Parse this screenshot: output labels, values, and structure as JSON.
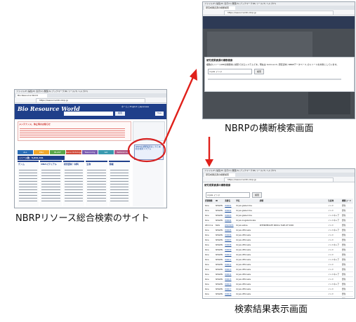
{
  "captions": {
    "shot1": "NBRPリソース総合検索のサイト",
    "shot2": "NBRPの横断検索画面",
    "shot3": "検索結果表示画面"
  },
  "browser": {
    "menu": "ファイル(F) 編集(E) 表示(V) 履歴(S) ブックマーク(B) ツール(T) ヘルプ(H)",
    "url": "https://resourceinfo.nbrp.jp"
  },
  "shot1": {
    "site_title": "Bio Resource World",
    "lang": "ホーム | English | Japanese",
    "search_button": "検索",
    "notice_title": "メンテナンス、休止等のお知らせ",
    "resources_header": "リソース数：5,042,461",
    "help": "Help",
    "cat_tabs": [
      "ALL",
      "DNA",
      "BLAST",
      "Gene Ontology",
      "Taxonomy",
      "GO",
      "Reference"
    ],
    "columns": [
      "ゲノム",
      "DNAマテリアル",
      "研究資材・材料",
      "生物",
      "情報"
    ],
    "link_box": "NBRPの横断検索はこちら ▶ 統合検索システム"
  },
  "shot2": {
    "heading": "研究成果資源の横断検索",
    "desc": "複数のリソースDBを横断的に検索できるシステムです。現在は SciCrunch, 研究資材, NBRPデータベース のリソースを対象としています。",
    "input_value": "oryza インド",
    "search_button": "検索"
  },
  "shot3": {
    "heading": "研究成果資源の横断検索",
    "input_value": "oryza インド",
    "search_button": "検索",
    "columns": [
      "資源種類",
      "ID",
      "系統名",
      "学名",
      "詳細",
      "生産地",
      "機関コード"
    ],
    "rows": [
      {
        "kind": "Rice",
        "db": "SHIGEN",
        "id": "W0001",
        "name": "Oryza glaberrima",
        "note": "",
        "origin": "インド",
        "inst": "野生"
      },
      {
        "kind": "Rice",
        "db": "SHIGEN",
        "id": "W0002",
        "name": "Oryza glaberrima",
        "note": "",
        "origin": "インド",
        "inst": "野生"
      },
      {
        "kind": "Rice",
        "db": "SHIGEN",
        "id": "W0003",
        "name": "Oryza glaberrima",
        "note": "",
        "origin": "インドネシア",
        "inst": "野生"
      },
      {
        "kind": "Rice",
        "db": "SHIGEN",
        "id": "W0004",
        "name": "Oryza longistaminata",
        "note": "",
        "origin": "インドネシア",
        "inst": "野生"
      },
      {
        "kind": "Wild rice",
        "db": "NIAS",
        "id": "JP203055",
        "name": "Oryza sativa",
        "note": "INTERMEDIATE INDICA TAKE-OF 0000",
        "origin": "インド",
        "inst": "野生"
      },
      {
        "kind": "Rice",
        "db": "SHIGEN",
        "id": "W0005",
        "name": "Oryza officinalis",
        "note": "",
        "origin": "インドネシア",
        "inst": "野生"
      },
      {
        "kind": "Rice",
        "db": "SHIGEN",
        "id": "W0006",
        "name": "Oryza officinalis",
        "note": "",
        "origin": "インド",
        "inst": "野生"
      },
      {
        "kind": "Rice",
        "db": "SHIGEN",
        "id": "W0007",
        "name": "Oryza officinalis",
        "note": "",
        "origin": "インド",
        "inst": "野生"
      },
      {
        "kind": "Rice",
        "db": "SHIGEN",
        "id": "W0008",
        "name": "Oryza officinalis",
        "note": "",
        "origin": "インドネシア",
        "inst": "野生"
      },
      {
        "kind": "Rice",
        "db": "SHIGEN",
        "id": "W0009",
        "name": "Oryza officinalis",
        "note": "",
        "origin": "インド",
        "inst": "野生"
      },
      {
        "kind": "Rice",
        "db": "SHIGEN",
        "id": "W0010",
        "name": "Oryza officinalis",
        "note": "",
        "origin": "インド",
        "inst": "野生"
      },
      {
        "kind": "Rice",
        "db": "SHIGEN",
        "id": "W0011",
        "name": "Oryza officinalis",
        "note": "",
        "origin": "インドネシア",
        "inst": "野生"
      },
      {
        "kind": "Rice",
        "db": "SHIGEN",
        "id": "W0012",
        "name": "Oryza officinalis",
        "note": "",
        "origin": "インド",
        "inst": "野生"
      },
      {
        "kind": "Rice",
        "db": "SHIGEN",
        "id": "W0013",
        "name": "Oryza officinalis",
        "note": "",
        "origin": "インド",
        "inst": "野生"
      },
      {
        "kind": "Rice",
        "db": "SHIGEN",
        "id": "W0014",
        "name": "Oryza officinalis",
        "note": "",
        "origin": "インドネシア",
        "inst": "野生"
      },
      {
        "kind": "Rice",
        "db": "SHIGEN",
        "id": "W0015",
        "name": "Oryza officinalis",
        "note": "",
        "origin": "インド",
        "inst": "野生"
      },
      {
        "kind": "Rice",
        "db": "SHIGEN",
        "id": "W0016",
        "name": "Oryza officinalis",
        "note": "",
        "origin": "インドネシア",
        "inst": "野生"
      },
      {
        "kind": "Rice",
        "db": "SHIGEN",
        "id": "W0017",
        "name": "Oryza officinalis",
        "note": "",
        "origin": "インド",
        "inst": "野生"
      },
      {
        "kind": "Rice",
        "db": "SHIGEN",
        "id": "W0018",
        "name": "Oryza officinalis",
        "note": "",
        "origin": "インド",
        "inst": "野生"
      },
      {
        "kind": "Rice",
        "db": "SHIGEN",
        "id": "W0019",
        "name": "Oryza officinalis",
        "note": "",
        "origin": "インド",
        "inst": "野生"
      },
      {
        "kind": "Rice",
        "db": "SHIGEN",
        "id": "W0020",
        "name": "Oryza officinalis",
        "note": "",
        "origin": "インド",
        "inst": "野生"
      },
      {
        "kind": "Wild rice",
        "db": "NIAS",
        "id": "JP203061",
        "name": "Oryza sativa",
        "note": "EXPERIENCE OPPORTUNIST COMPLEX COOL INDIA INTERMEDIATE",
        "origin": "インド",
        "inst": "野生"
      },
      {
        "kind": "Rice",
        "db": "SHIGEN",
        "id": "W0021",
        "name": "Oryza officinalis",
        "note": "",
        "origin": "インド",
        "inst": "野生"
      },
      {
        "kind": "Wild rice",
        "db": "NIAS",
        "id": "JP203062",
        "name": "Oryza sativa",
        "note": "",
        "origin": "インド",
        "inst": "野生"
      }
    ]
  },
  "colors": {
    "accent_red": "#e0201a",
    "ring": "#d62020",
    "nav_blue": "#1f3f8a",
    "tab_colors": [
      "#2a6db5",
      "#f1a62a",
      "#5aa64a",
      "#d04a3a",
      "#7a5cb0",
      "#3a9ab0",
      "#b05c8a"
    ]
  }
}
